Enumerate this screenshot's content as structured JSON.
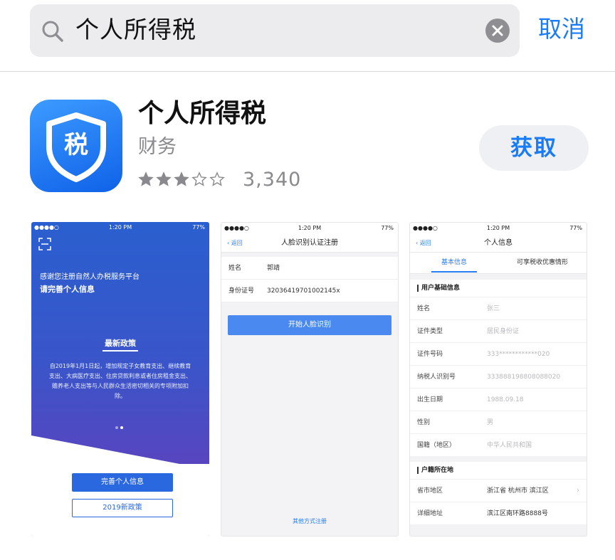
{
  "search": {
    "query": "个人所得税",
    "cancel_label": "取消"
  },
  "app": {
    "name": "个人所得税",
    "category": "财务",
    "icon_glyph": "税",
    "rating_stars": 3,
    "rating_max": 5,
    "rating_count": "3,340",
    "get_label": "获取",
    "accent_color": "#1a7cf5"
  },
  "screenshots": {
    "shot1": {
      "status_time": "1:20 PM",
      "status_battery": "77%",
      "intro_line1": "感谢您注册自然人办税服务平台",
      "intro_line2": "请完善个人信息",
      "policy_title": "最新政策",
      "policy_text": "自2019年1月1日起，增加规定子女教育支出、继续教育支出、大病医疗支出、住房贷款利息或者住房租金支出、赡养老人支出等与人民群众生活密切相关的专项附加扣除。",
      "primary_button": "完善个人信息",
      "secondary_button": "2019新政策"
    },
    "shot2": {
      "status_time": "1:20 PM",
      "status_battery": "77%",
      "back_label": "返回",
      "title": "人脸识别认证注册",
      "fields": [
        {
          "label": "姓名",
          "value": "郭靖"
        },
        {
          "label": "身份证号",
          "value": "320364197010021­45x"
        }
      ],
      "button": "开始人脸识别",
      "other_link": "其他方式注册"
    },
    "shot3": {
      "status_time": "1:20 PM",
      "status_battery": "77%",
      "back_label": "返回",
      "title": "个人信息",
      "tabs": [
        "基本信息",
        "可享税收优惠情形"
      ],
      "section1_title": "用户基础信息",
      "section1_rows": [
        {
          "label": "姓名",
          "value": "张三"
        },
        {
          "label": "证件类型",
          "value": "居民身份证"
        },
        {
          "label": "证件号码",
          "value": "333************020"
        },
        {
          "label": "纳税人识别号",
          "value": "333888198808088020"
        },
        {
          "label": "出生日期",
          "value": "1988.09.18"
        },
        {
          "label": "性别",
          "value": "男"
        },
        {
          "label": "国籍（地区）",
          "value": "中华人民共和国"
        }
      ],
      "section2_title": "户籍所在地",
      "section2_rows": [
        {
          "label": "省市地区",
          "value": "浙江省 杭州市 滨江区"
        },
        {
          "label": "详细地址",
          "value": "滨江区南环路8888号"
        }
      ]
    }
  }
}
